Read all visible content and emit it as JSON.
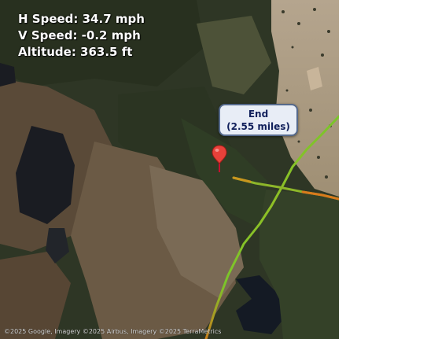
{
  "stats": {
    "h_speed": "H Speed: 34.7 mph",
    "v_speed": "V Speed: -0.2 mph",
    "altitude": "Altitude: 363.5 ft"
  },
  "callout": {
    "title": "End",
    "distance": "(2.55 miles)"
  },
  "attribution": "©2025 Google, Imagery ©2025 Airbus, Imagery ©2025 TerraMetrics",
  "colors": {
    "track_green": "#7ac52a",
    "track_orange": "#d97a1c",
    "marker_red": "#e8413a",
    "callout_border": "#566a8c",
    "callout_text": "#11205b"
  },
  "icons": {
    "marker": "map-pin-icon"
  }
}
